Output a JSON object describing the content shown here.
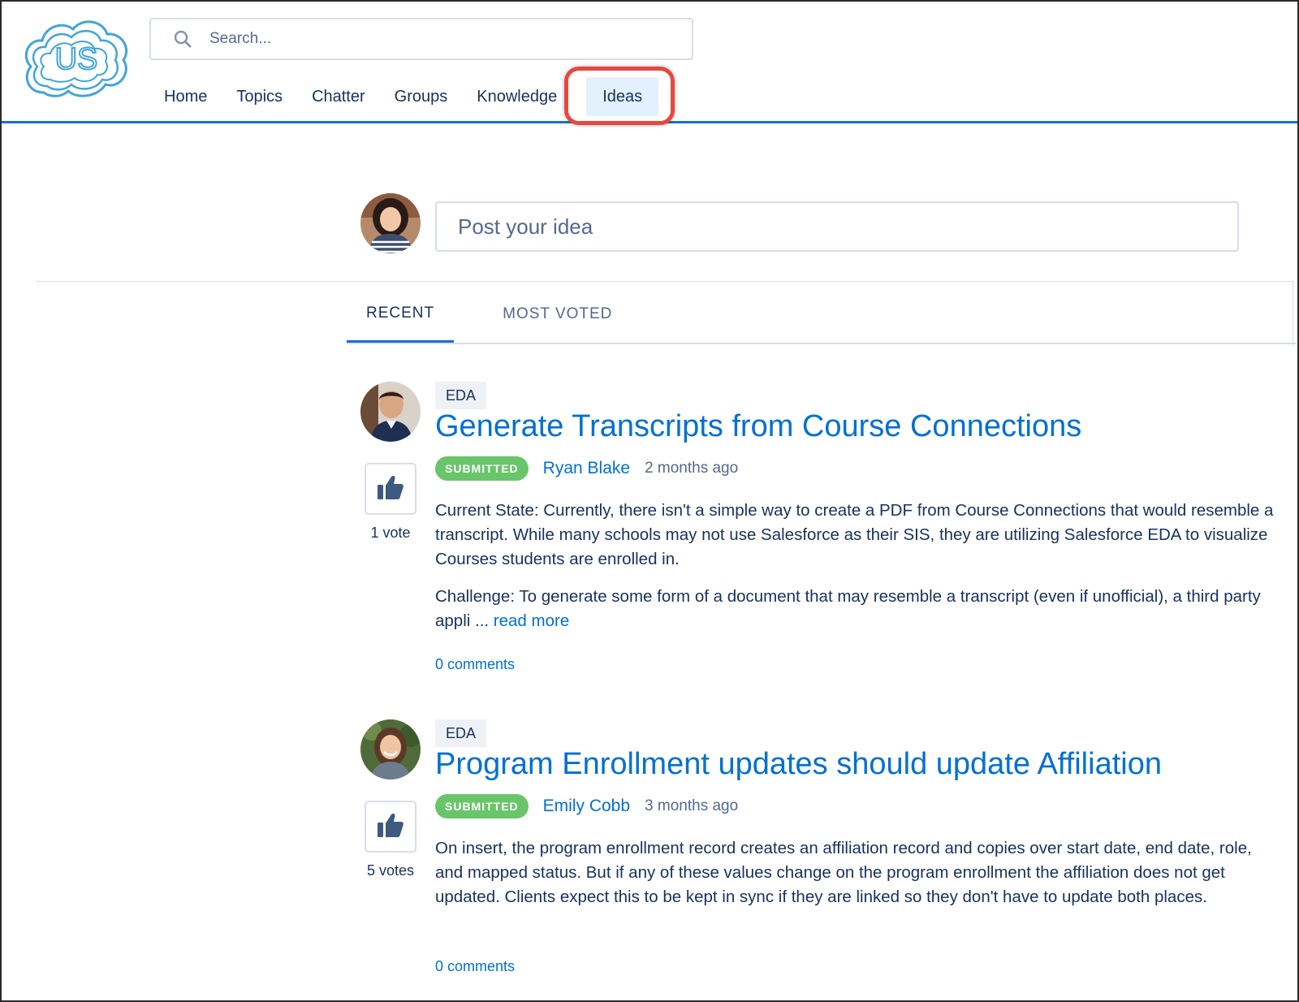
{
  "logo": {
    "text": "US",
    "color": "#41a5d8"
  },
  "search": {
    "placeholder": "Search..."
  },
  "nav": {
    "items": [
      {
        "label": "Home"
      },
      {
        "label": "Topics"
      },
      {
        "label": "Chatter"
      },
      {
        "label": "Groups"
      },
      {
        "label": "Knowledge"
      },
      {
        "label": "Ideas",
        "active": true
      }
    ]
  },
  "composer": {
    "placeholder": "Post your idea"
  },
  "tabs": [
    {
      "label": "RECENT",
      "active": true
    },
    {
      "label": "MOST VOTED"
    }
  ],
  "ideas": [
    {
      "topic": "EDA",
      "title": "Generate Transcripts from Course Connections",
      "status": "SUBMITTED",
      "author": "Ryan Blake",
      "time": "2 months ago",
      "votes": "1 vote",
      "body": [
        "Current State: Currently, there isn't a simple way to create a PDF from Course Connections that would resemble a transcript. While many schools may not use Salesforce as their SIS, they are utilizing Salesforce EDA to visualize Courses students are enrolled in.",
        "Challenge: To generate some form of a document that may resemble a transcript (even if unofficial), a third party appli ... "
      ],
      "read_more": "read more",
      "comments": "0 comments"
    },
    {
      "topic": "EDA",
      "title": "Program Enrollment updates should update Affiliation",
      "status": "SUBMITTED",
      "author": "Emily Cobb",
      "time": "3 months ago",
      "votes": "5 votes",
      "body": [
        "On insert, the program enrollment record creates an affiliation record and copies over start date, end date, role, and mapped status. But if any of these values change on the program enrollment the affiliation does not get updated. Clients expect this to be kept in sync if they are linked so they don't have to update both places."
      ],
      "comments": "0 comments"
    }
  ],
  "colors": {
    "accent": "#0070d2",
    "nav_border": "#1b6fc9",
    "status_green": "#69c56a",
    "highlight_red": "#e8483f",
    "vote_icon": "#3d5a80"
  },
  "icons": {
    "search": "search-icon",
    "vote": "thumbs-up-icon"
  }
}
